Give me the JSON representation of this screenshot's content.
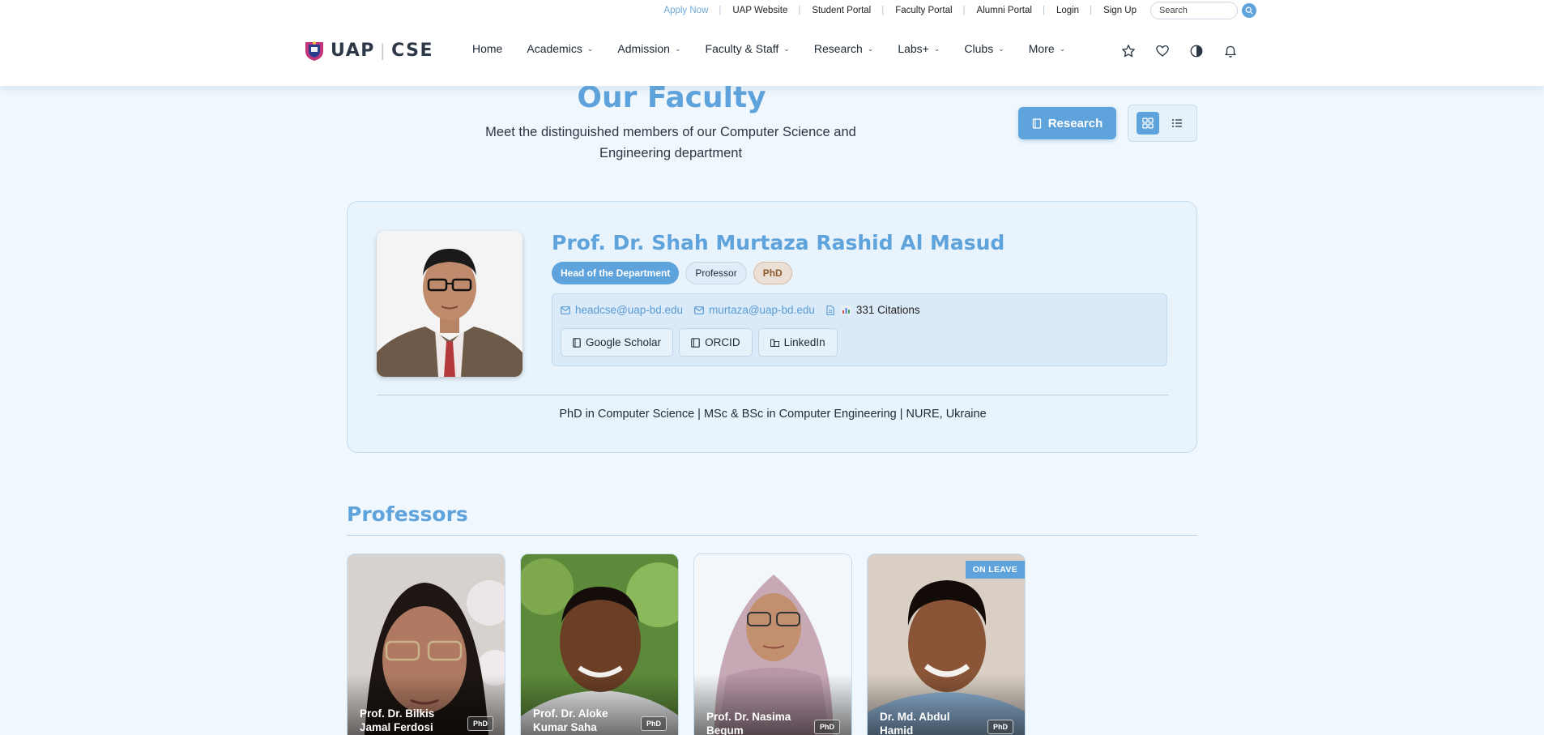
{
  "topbar": {
    "links": [
      "Apply Now",
      "UAP Website",
      "Student Portal",
      "Faculty Portal",
      "Alumni Portal",
      "Login",
      "Sign Up"
    ],
    "search_placeholder": "Search"
  },
  "logo": {
    "left": "UAP",
    "right": "CSE"
  },
  "nav": {
    "items": [
      "Home",
      "Academics",
      "Admission",
      "Faculty & Staff",
      "Research",
      "Labs+",
      "Clubs",
      "More"
    ]
  },
  "icons": [
    "star-icon",
    "heart-icon",
    "contrast-icon",
    "bell-icon"
  ],
  "page": {
    "title": "Our Faculty",
    "subtitle": "Meet the distinguished members of our Computer Science and Engineering department",
    "research_label": "Research"
  },
  "head": {
    "name": "Prof. Dr. Shah Murtaza Rashid Al Masud",
    "badges": {
      "role": "Head of the Department",
      "rank": "Professor",
      "degree": "PhD"
    },
    "emails": [
      "headcse@uap-bd.edu",
      "murtaza@uap-bd.edu"
    ],
    "citations": "331 Citations",
    "links": [
      "Google Scholar",
      "ORCID",
      "LinkedIn"
    ],
    "education": "PhD in Computer Science | MSc & BSc in Computer Engineering | NURE, Ukraine"
  },
  "professors": {
    "title": "Professors",
    "cards": [
      {
        "name": "Prof. Dr. Bilkis Jamal Ferdosi",
        "degree": "PhD"
      },
      {
        "name": "Prof. Dr. Aloke Kumar Saha",
        "degree": "PhD"
      },
      {
        "name": "Prof. Dr. Nasima Begum",
        "degree": "PhD"
      },
      {
        "name": "Dr. Md. Abdul Hamid",
        "degree": "PhD",
        "status": "ON LEAVE"
      }
    ]
  },
  "colors": {
    "accent": "#5fa3dc",
    "background": "#f1f8fd",
    "card": "#e8f3fc"
  }
}
